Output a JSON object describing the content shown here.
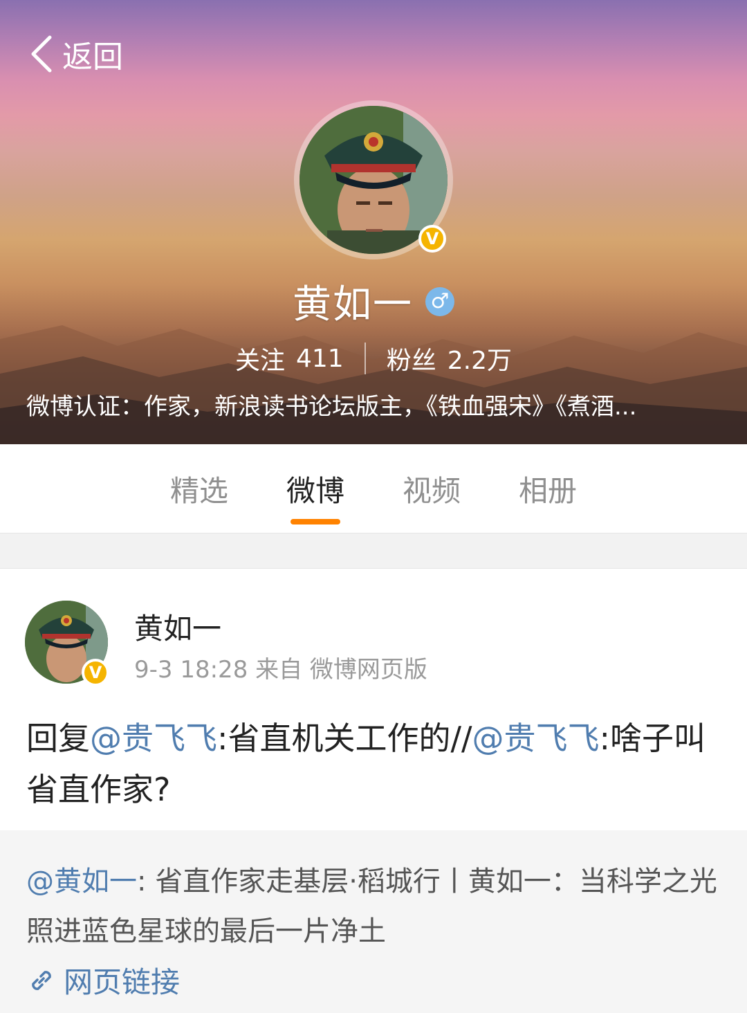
{
  "header": {
    "back_label": "返回",
    "name": "黄如一",
    "gender": "♂",
    "verified": "V",
    "following_label": "关注",
    "following_count": "411",
    "followers_label": "粉丝",
    "followers_count": "2.2万",
    "certification": "微博认证：作家，新浪读书论坛版主，《铁血强宋》《煮酒..."
  },
  "tabs": [
    {
      "label": "精选"
    },
    {
      "label": "微博"
    },
    {
      "label": "视频"
    },
    {
      "label": "相册"
    }
  ],
  "active_tab": "微博",
  "post": {
    "author": "黄如一",
    "verified": "V",
    "meta": "9-3 18:28 来自 微博网页版",
    "text_parts": [
      {
        "text": "回复"
      },
      {
        "text": "@贵飞飞"
      },
      {
        "text": ":省直机关工作的//"
      },
      {
        "text": "@贵飞飞"
      },
      {
        "text": ":啥子叫省直作家?"
      }
    ],
    "repost": {
      "mention": "@黄如一",
      "text": ": 省直作家走基层·稻城行丨黄如一：当科学之光照进蓝色星球的最后一片净土",
      "link_label": "网页链接"
    }
  },
  "colors": {
    "accent": "#ff8200",
    "link": "#507daf",
    "verified": "#f5b400",
    "gender": "#7cb8ea"
  },
  "icons": [
    "back-chevron-icon",
    "verified-icon",
    "male-gender-icon",
    "link-icon"
  ]
}
